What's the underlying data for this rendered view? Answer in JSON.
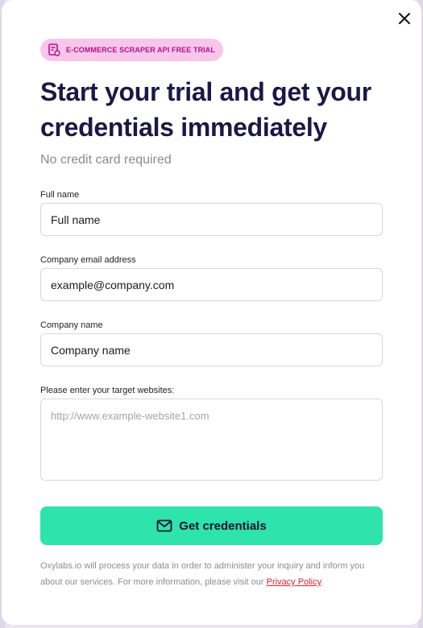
{
  "badge": {
    "text": "E-COMMERCE SCRAPER API FREE TRIAL"
  },
  "title": "Start your trial and get your credentials immediately",
  "subtitle": "No credit card required",
  "form": {
    "full_name": {
      "label": "Full name",
      "value": "Full name"
    },
    "email": {
      "label": "Company email address",
      "value": "example@company.com"
    },
    "company": {
      "label": "Company name",
      "value": "Company name"
    },
    "websites": {
      "label": "Please enter your target websites:",
      "placeholder": "http://www.example-website1.com"
    }
  },
  "cta": {
    "label": "Get credentials"
  },
  "legal": {
    "text": "Oxylabs.io will process your data in order to administer your inquiry and inform you about our services. For more information, please visit our",
    "link": "Privacy Policy",
    "end": "."
  },
  "colors": {
    "accent": "#2ee3ac",
    "badge_bg": "#f8c6ea",
    "badge_text": "#b3128c",
    "title": "#1b1845",
    "link": "#e5222f"
  },
  "icons": {
    "close": "close-icon",
    "badge": "cart-document-icon",
    "cta": "mail-icon"
  }
}
